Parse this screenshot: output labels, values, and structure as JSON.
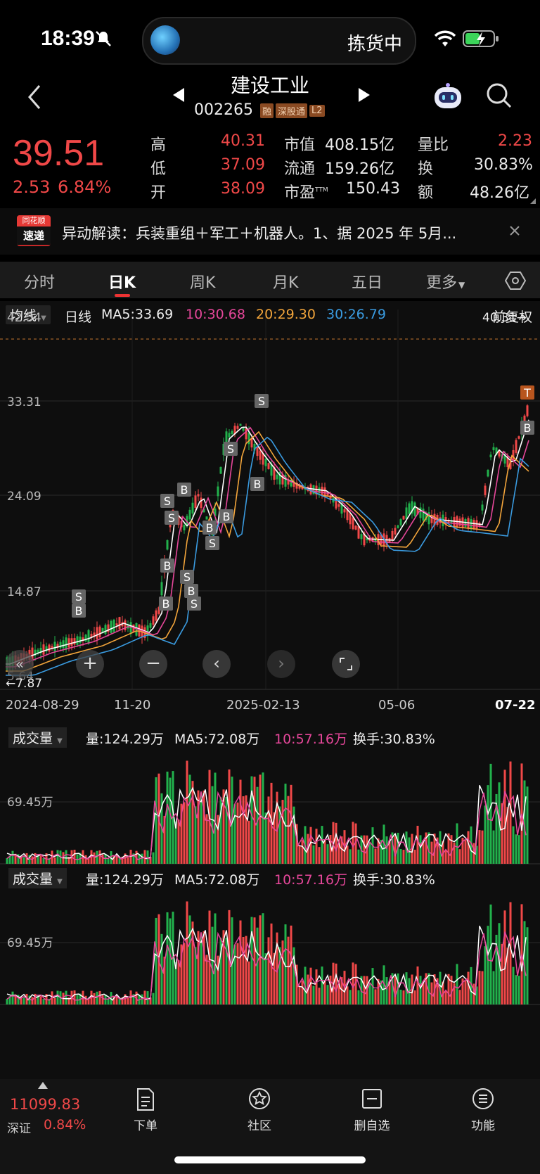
{
  "status": {
    "time": "18:39",
    "dynamic_island_text": "拣货中"
  },
  "header": {
    "title": "建设工业",
    "code": "002265",
    "tags": [
      "融",
      "深股通",
      "L2"
    ]
  },
  "quote": {
    "price": "39.51",
    "change": "2.53",
    "change_pct": "6.84%",
    "high_label": "高",
    "high": "40.31",
    "low_label": "低",
    "low": "37.09",
    "open_label": "开",
    "open": "38.09",
    "mcap_label": "市值",
    "mcap": "408.15亿",
    "float_label": "流通",
    "float": "159.26亿",
    "pe_label": "市盈",
    "pe_sup": "TTM",
    "pe": "150.43",
    "vr_label": "量比",
    "vr": "2.23",
    "turn_label": "换",
    "turn": "30.83%",
    "amt_label": "额",
    "amt": "48.26亿"
  },
  "news": {
    "logo_line1": "同花顺",
    "logo_line2": "速递",
    "text": "异动解读：兵装重组＋军工＋机器人。1、据 2025 年 5月..."
  },
  "tabs": [
    {
      "label": "分时"
    },
    {
      "label": "日K"
    },
    {
      "label": "周K"
    },
    {
      "label": "月K"
    },
    {
      "label": "五日"
    },
    {
      "label": "更多"
    }
  ],
  "chart": {
    "ma_selector": "均线",
    "period": "日线",
    "ma5": "MA5:33.69",
    "ma10": "10:30.68",
    "ma20": "20:29.30",
    "ma30": "30:26.79",
    "adjust": "前复权",
    "yticks": [
      "42.54",
      "33.31",
      "24.09",
      "14.87",
      "5.64"
    ],
    "high_marker": "40.31→",
    "low_marker": "←7.87",
    "xticks": [
      "2024-08-29",
      "11-20",
      "2025-02-13",
      "05-06",
      "07-22"
    ],
    "colors": {
      "up": "#f04848",
      "down": "#22b14c",
      "ma5": "#ffffff",
      "ma10": "#e6479a",
      "ma20": "#f3a53b",
      "ma30": "#3a9be0"
    }
  },
  "volume_panels": [
    {
      "label": "成交量",
      "vol": "量:124.29万",
      "ma5": "MA5:72.08万",
      "ma10": "10:57.16万",
      "turn": "换手:30.83%",
      "ytick": "69.45万"
    },
    {
      "label": "成交量",
      "vol": "量:124.29万",
      "ma5": "MA5:72.08万",
      "ma10": "10:57.16万",
      "turn": "换手:30.83%",
      "ytick": "69.45万"
    }
  ],
  "bottom": {
    "index_value": "11099.83",
    "index_name": "深证",
    "index_pct": "0.84%",
    "nav": [
      {
        "label": "下单"
      },
      {
        "label": "社区"
      },
      {
        "label": "删自选"
      },
      {
        "label": "功能"
      }
    ]
  }
}
